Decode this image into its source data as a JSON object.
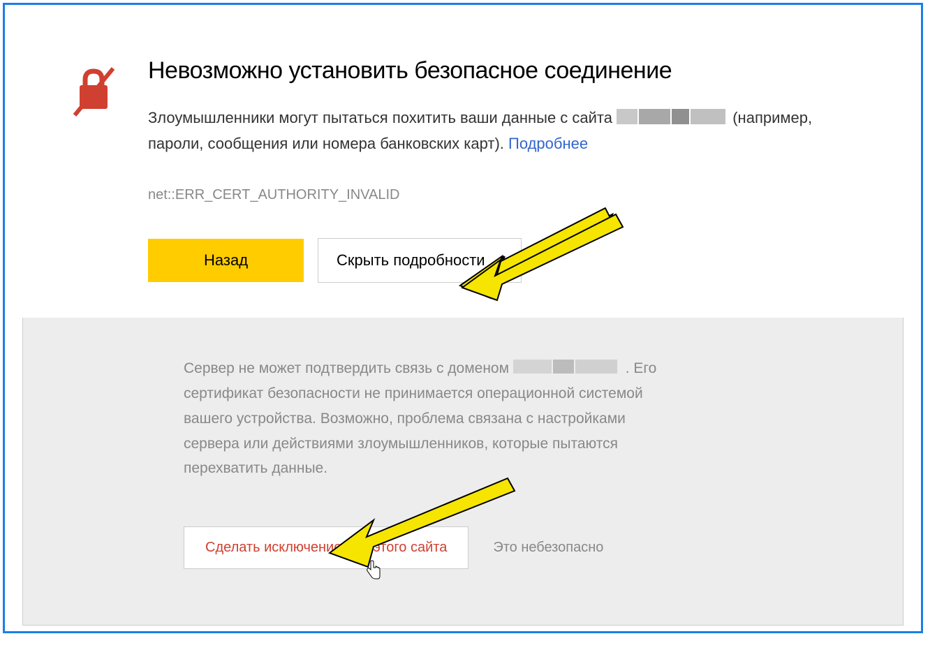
{
  "title": "Невозможно установить безопасное соединение",
  "warning_prefix": "Злоумышленники могут пытаться похитить ваши данные с сайта ",
  "warning_suffix": " (например, пароли, сообщения или номера банковских карт). ",
  "learn_more": "Подробнее",
  "error_code": "net::ERR_CERT_AUTHORITY_INVALID",
  "buttons": {
    "back": "Назад",
    "hide_details": "Скрыть подробности",
    "exception": "Сделать исключение для этого сайта"
  },
  "details": {
    "prefix": "Сервер не может подтвердить связь с доменом",
    "suffix": ". Его сертификат безопасности не принимается операционной системой вашего устройства. Возможно, проблема связана с настройками сервера или действиями злоумышленников, которые пытаются перехватить данные."
  },
  "unsafe_label": "Это небезопасно"
}
